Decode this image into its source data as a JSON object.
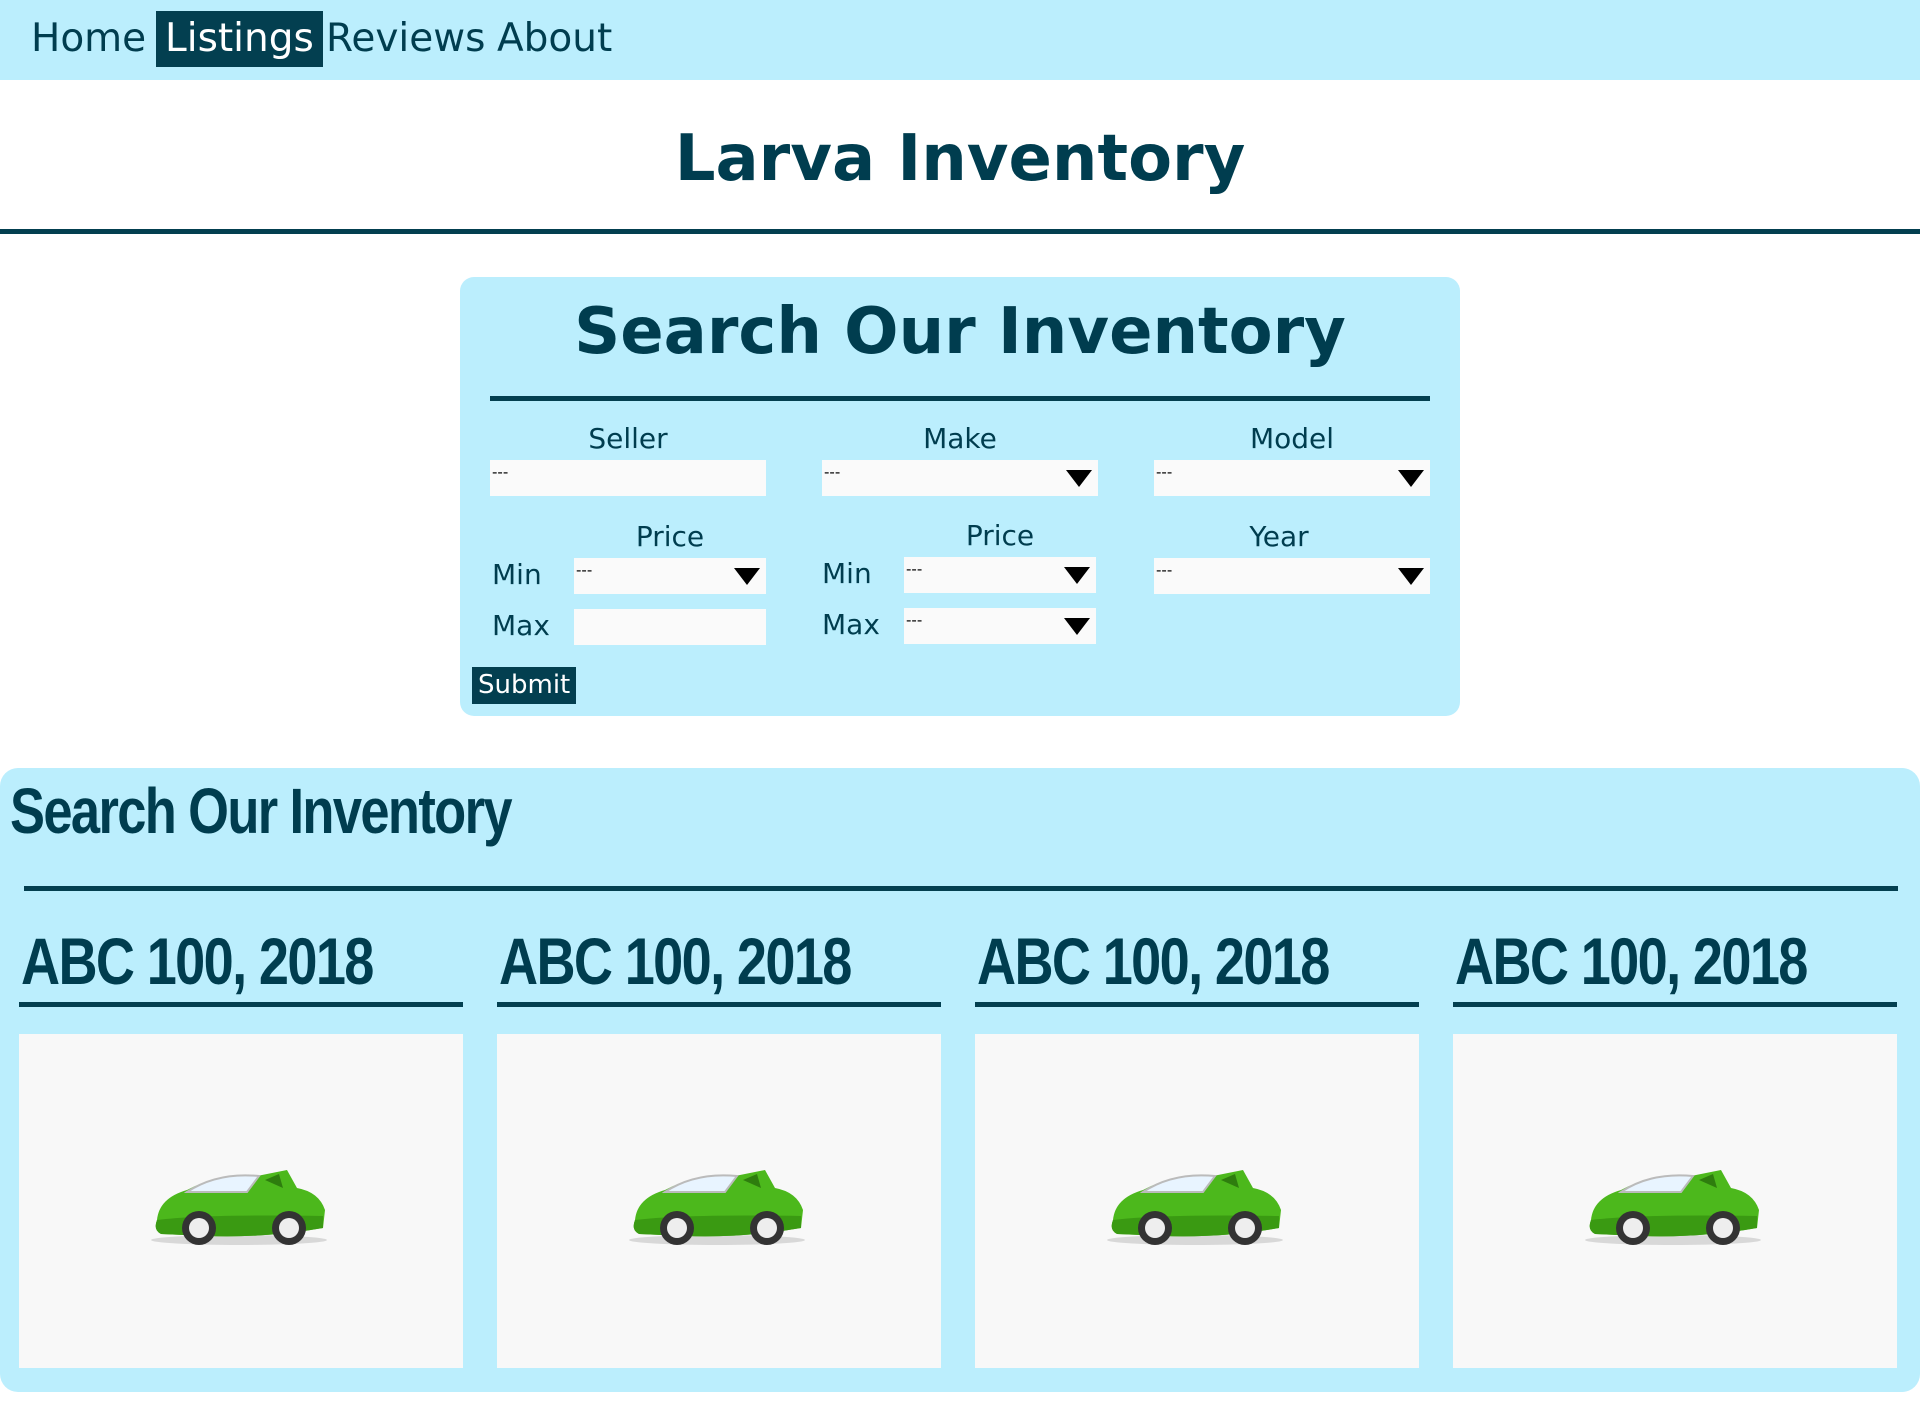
{
  "nav": {
    "items": [
      {
        "label": "Home",
        "active": false
      },
      {
        "label": "Listings",
        "active": true
      },
      {
        "label": "Reviews",
        "active": false
      },
      {
        "label": "About",
        "active": false
      }
    ]
  },
  "header": {
    "title": "Larva Inventory"
  },
  "search": {
    "title": "Search Our Inventory",
    "seller": {
      "label": "Seller",
      "value": "---"
    },
    "make": {
      "label": "Make",
      "value": "---"
    },
    "model": {
      "label": "Model",
      "value": "---"
    },
    "price_1": {
      "label": "Price",
      "min_label": "Min",
      "max_label": "Max",
      "min_value": "---",
      "max_value": ""
    },
    "price_2": {
      "label": "Price",
      "min_label": "Min",
      "max_label": "Max",
      "min_value": "---",
      "max_value": "---"
    },
    "year": {
      "label": "Year",
      "value": "---"
    },
    "submit_label": "Submit"
  },
  "results": {
    "title": "Search Our Inventory",
    "cards": [
      {
        "title": "ABC 100, 2018",
        "image_icon": "green-car-icon"
      },
      {
        "title": "ABC 100, 2018",
        "image_icon": "green-car-icon"
      },
      {
        "title": "ABC 100, 2018",
        "image_icon": "green-car-icon"
      },
      {
        "title": "ABC 100, 2018",
        "image_icon": "green-car-icon"
      }
    ]
  },
  "colors": {
    "accent_dark": "#033f50",
    "panel_bg": "#bbeefd",
    "text": "#003d4f",
    "car_green": "#4cb81c"
  }
}
